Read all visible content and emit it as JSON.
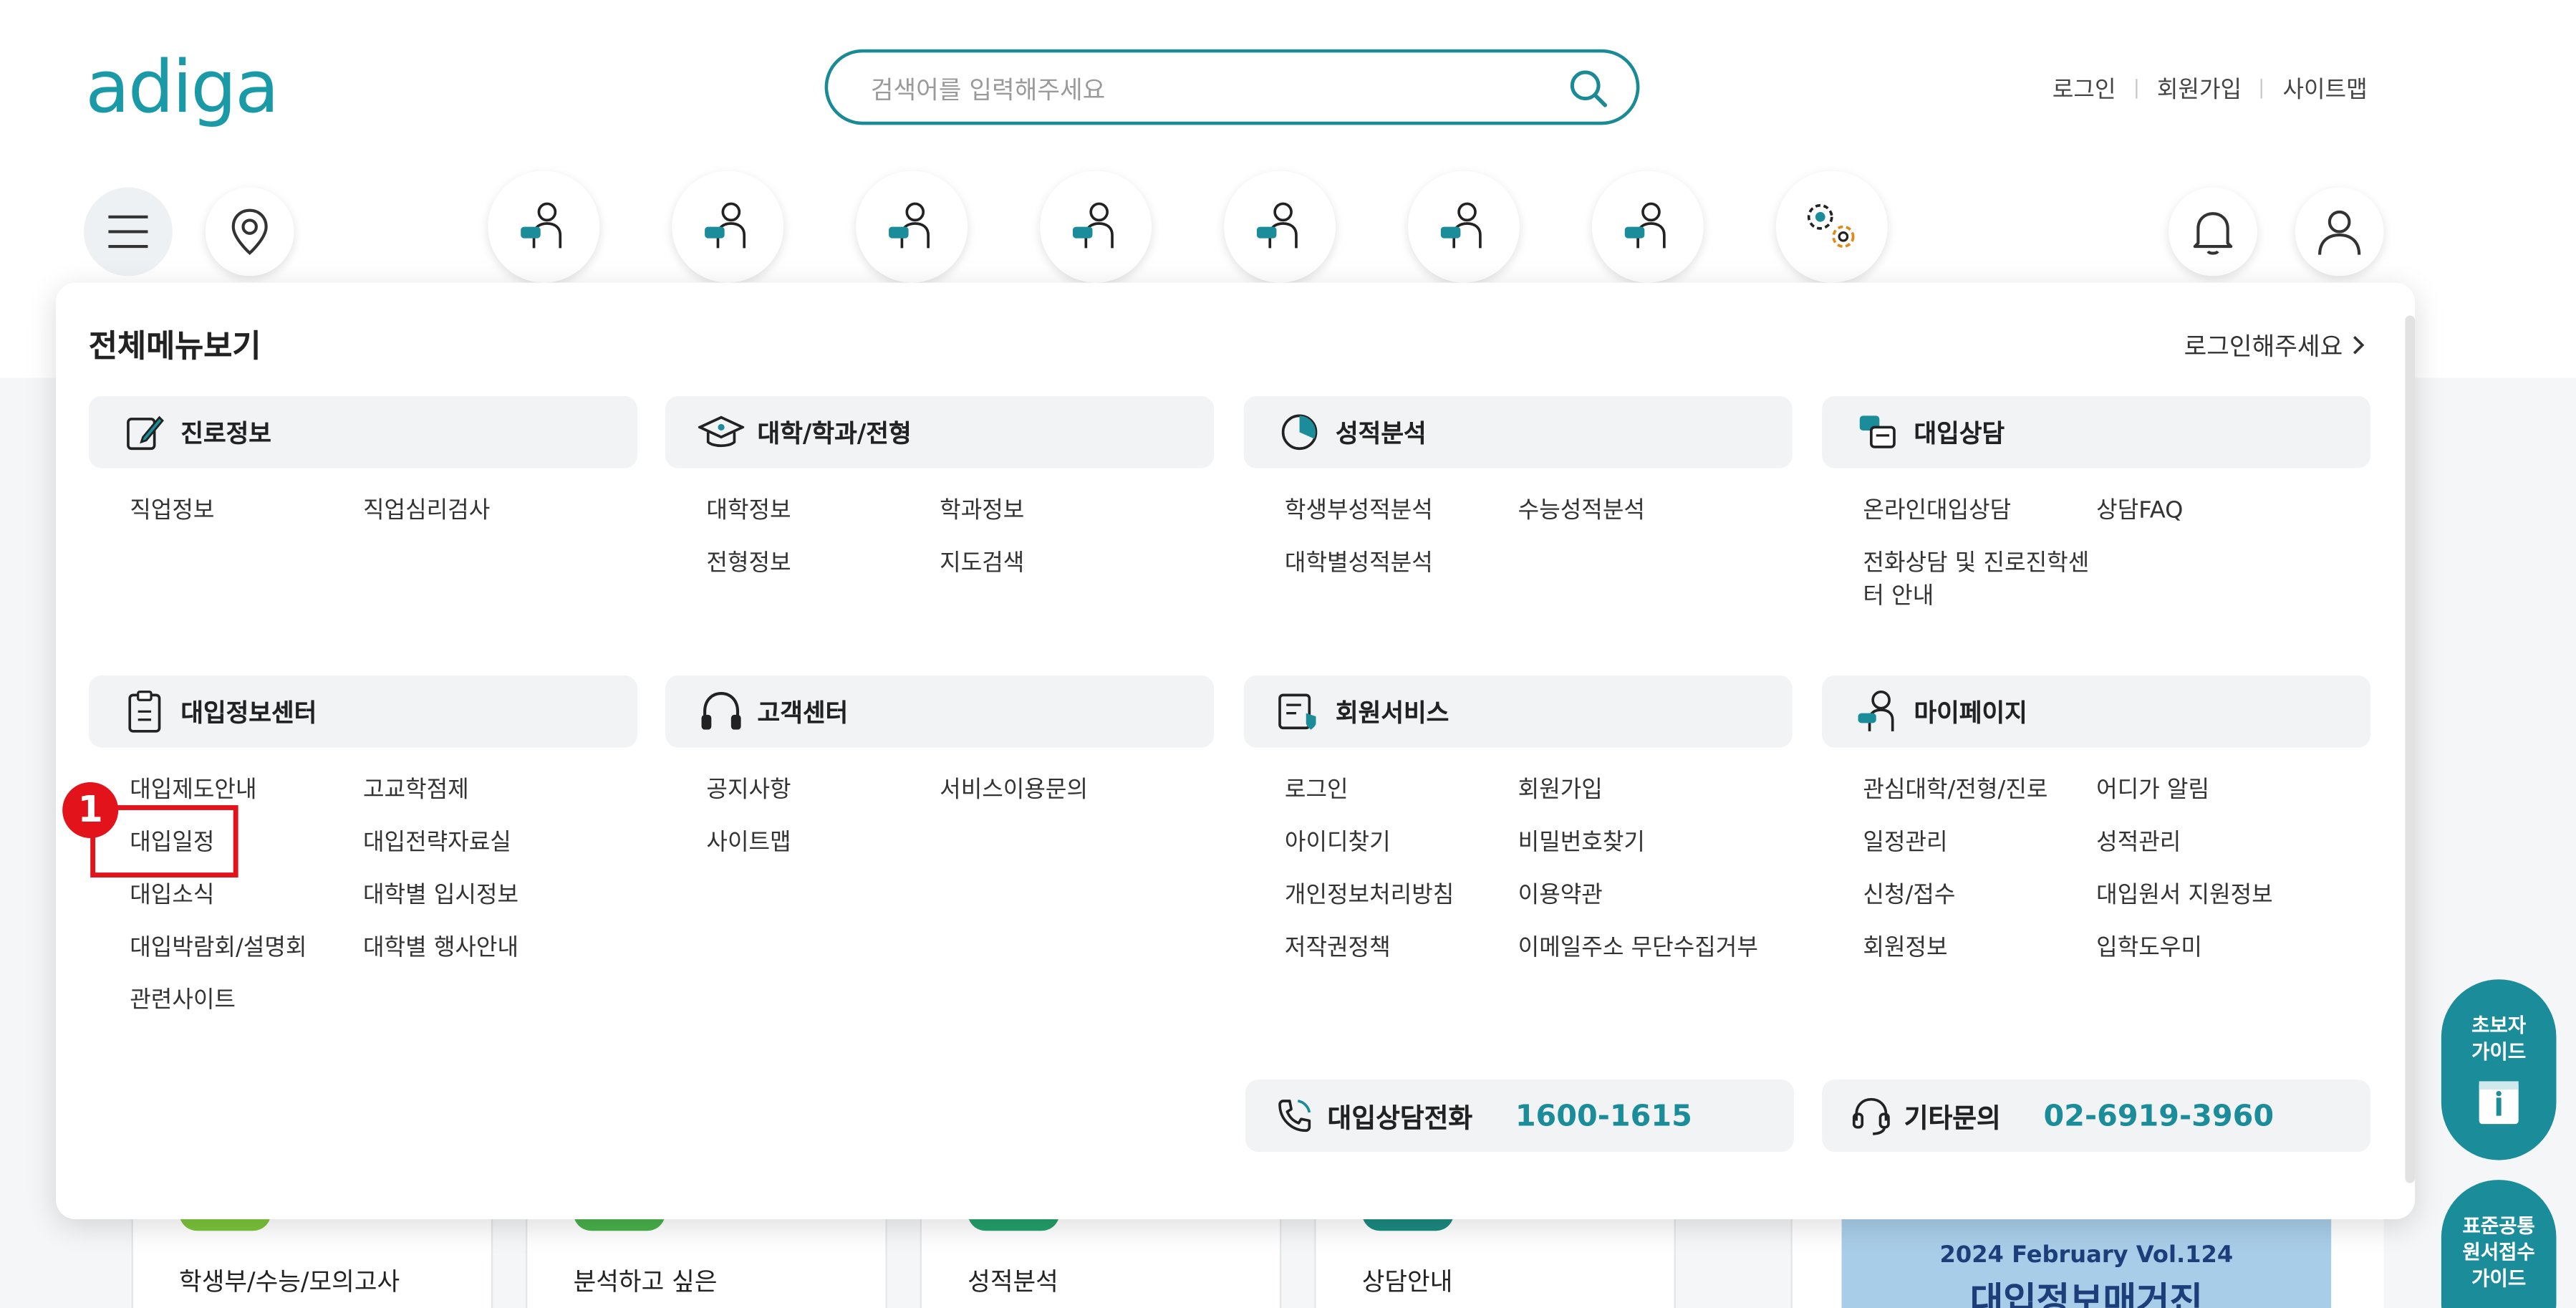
{
  "header": {
    "logo": "adiga",
    "search_placeholder": "검색어를 입력해주세요",
    "links": [
      "로그인",
      "회원가입",
      "사이트맵"
    ]
  },
  "below": {
    "cards": [
      "학생부/수능/모의고사",
      "분석하고 싶은",
      "성적분석",
      "상담안내"
    ],
    "magazine": "2024 February Vol.124",
    "magazine_title": "대입정보매거진"
  },
  "panel": {
    "title": "전체메뉴보기",
    "login_link": "로그인해주세요",
    "sections": [
      {
        "title": "진로정보",
        "items": [
          "직업정보",
          "직업심리검사"
        ]
      },
      {
        "title": "대학/학과/전형",
        "items": [
          "대학정보",
          "학과정보",
          "전형정보",
          "지도검색"
        ]
      },
      {
        "title": "성적분석",
        "items": [
          "학생부성적분석",
          "수능성적분석",
          "대학별성적분석"
        ]
      },
      {
        "title": "대입상담",
        "items": [
          "온라인대입상담",
          "상담FAQ",
          "전화상담 및 진로진학센터 안내"
        ]
      },
      {
        "title": "대입정보센터",
        "items": [
          "대입제도안내",
          "고교학점제",
          "대입일정",
          "대입전략자료실",
          "대입소식",
          "대학별 입시정보",
          "대입박람회/설명회",
          "대학별 행사안내",
          "관련사이트"
        ]
      },
      {
        "title": "고객센터",
        "items": [
          "공지사항",
          "서비스이용문의",
          "사이트맵"
        ]
      },
      {
        "title": "회원서비스",
        "items": [
          "로그인",
          "회원가입",
          "아이디찾기",
          "비밀번호찾기",
          "개인정보처리방침",
          "이용약관",
          "저작권정책",
          "이메일주소 무단수집거부"
        ]
      },
      {
        "title": "마이페이지",
        "items": [
          "관심대학/전형/진로",
          "어디가 알림",
          "일정관리",
          "성적관리",
          "신청/접수",
          "대입원서 지원정보",
          "회원정보",
          "입학도우미"
        ]
      }
    ],
    "contacts": [
      {
        "label": "대입상담전화",
        "number": "1600-1615"
      },
      {
        "label": "기타문의",
        "number": "02-6919-3960"
      }
    ]
  },
  "annotation": {
    "badge": "1"
  },
  "side_buttons": [
    {
      "line1": "초보자",
      "line2": "가이드"
    },
    {
      "line1": "표준공통",
      "line2": "원서접수",
      "line3": "가이드"
    }
  ]
}
